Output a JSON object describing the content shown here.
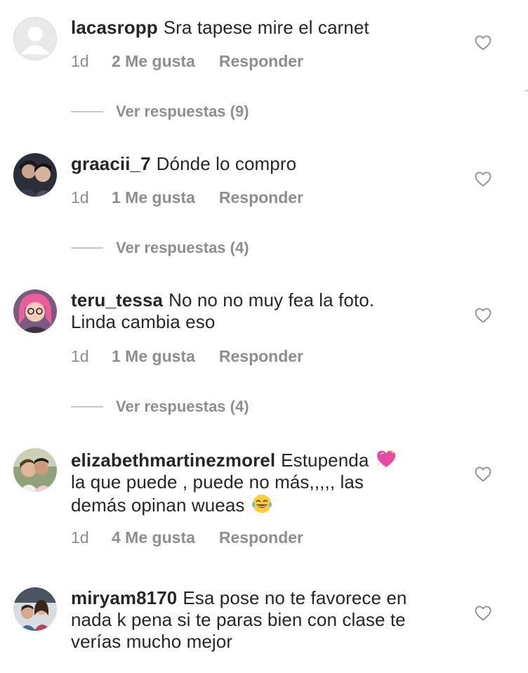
{
  "comments": [
    {
      "username": "lacasropp",
      "text": "Sra tapese mire el carnet",
      "time": "1d",
      "likes": "2 Me gusta",
      "reply": "Responder",
      "view_replies": "Ver respuestas (9)",
      "avatar": "default-profile-icon"
    },
    {
      "username": "graacii_7",
      "text": "Dónde lo compro",
      "time": "1d",
      "likes": "1 Me gusta",
      "reply": "Responder",
      "view_replies": "Ver respuestas (4)",
      "avatar": "photo"
    },
    {
      "username": "teru_tessa",
      "text_line1": "No no no muy fea la foto.",
      "text_line2": "Linda cambia eso",
      "time": "1d",
      "likes": "1 Me gusta",
      "reply": "Responder",
      "view_replies": "Ver respuestas (4)",
      "avatar": "photo"
    },
    {
      "username": "elizabethmartinezmorel",
      "text_part1": "Estupenda",
      "text_part2": "la que puede , puede no más,,,,, las",
      "text_part3": "demás opinan wueas",
      "emoji1": "sparkling-heart-emoji",
      "emoji2": "tears-of-joy-emoji",
      "time": "1d",
      "likes": "4 Me gusta",
      "reply": "Responder",
      "avatar": "photo"
    },
    {
      "username": "miryam8170",
      "text_line1": "Esa pose no te favorece en",
      "text_line2": "nada k pena si te paras bien con clase te",
      "text_line3": "verías mucho mejor",
      "avatar": "photo"
    }
  ],
  "icons": {
    "like": "heart-outline-icon"
  },
  "colors": {
    "text": "#262626",
    "secondary": "#8e8e8e",
    "divider": "#c7c7c7"
  }
}
